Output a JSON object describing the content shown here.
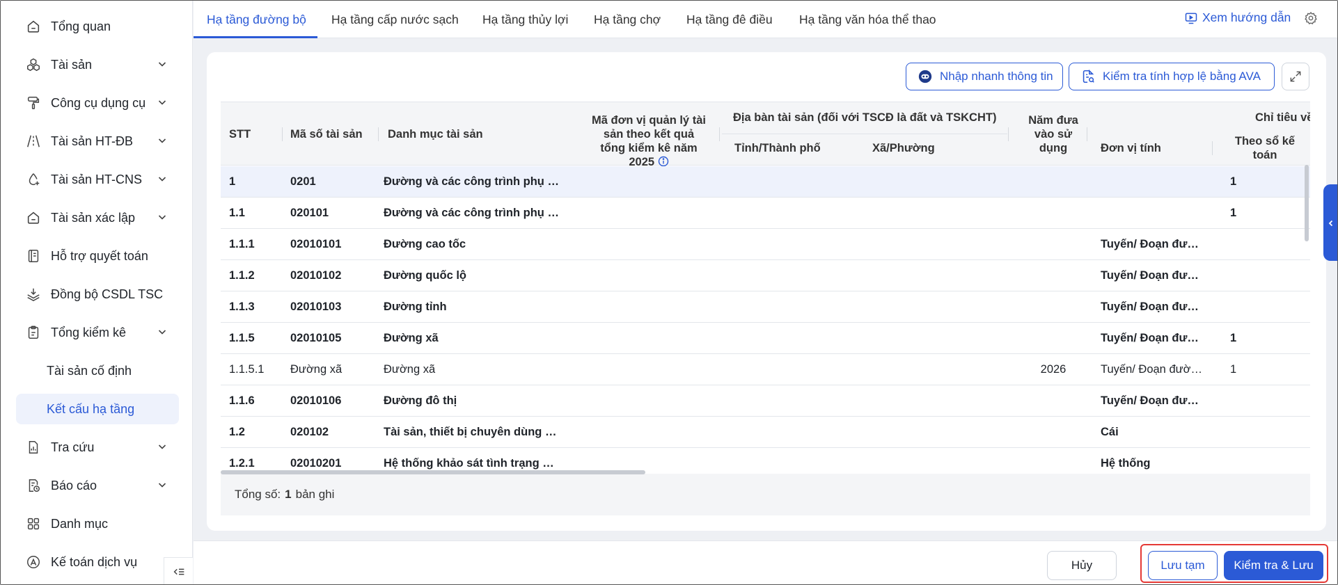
{
  "sidebar": {
    "items": [
      {
        "label": "Tổng quan",
        "icon": "home-icon",
        "has_chevron": false
      },
      {
        "label": "Tài sản",
        "icon": "cubes-icon",
        "has_chevron": true
      },
      {
        "label": "Công cụ dụng cụ",
        "icon": "paint-roller-icon",
        "has_chevron": true
      },
      {
        "label": "Tài sản HT-ĐB",
        "icon": "road-icon",
        "has_chevron": true
      },
      {
        "label": "Tài sản HT-CNS",
        "icon": "water-drop-icon",
        "has_chevron": true
      },
      {
        "label": "Tài sản xác lập",
        "icon": "building-icon",
        "has_chevron": true
      },
      {
        "label": "Hỗ trợ quyết toán",
        "icon": "ledger-icon",
        "has_chevron": false
      },
      {
        "label": "Đồng bộ CSDL TSC",
        "icon": "layers-sync-icon",
        "has_chevron": false
      },
      {
        "label": "Tổng kiểm kê",
        "icon": "clipboard-icon",
        "has_chevron": true
      },
      {
        "label": "Tài sản cố định",
        "icon": "",
        "has_chevron": false
      },
      {
        "label": "Kết cấu hạ tầng",
        "icon": "",
        "has_chevron": false
      },
      {
        "label": "Tra cứu",
        "icon": "document-chart-icon",
        "has_chevron": true
      },
      {
        "label": "Báo cáo",
        "icon": "report-clock-icon",
        "has_chevron": true
      },
      {
        "label": "Danh mục",
        "icon": "grid-icon",
        "has_chevron": false
      },
      {
        "label": "Kế toán dịch vụ",
        "icon": "accounting-icon",
        "has_chevron": false
      }
    ],
    "active_item": "Kết cấu hạ tầng"
  },
  "tabs": [
    {
      "label": "Hạ tầng đường bộ",
      "active": true
    },
    {
      "label": "Hạ tầng cấp nước sạch",
      "active": false
    },
    {
      "label": "Hạ tầng thủy lợi",
      "active": false
    },
    {
      "label": "Hạ tầng chợ",
      "active": false
    },
    {
      "label": "Hạ tầng đê điều",
      "active": false
    },
    {
      "label": "Hạ tầng văn hóa thể thao",
      "active": false
    }
  ],
  "header": {
    "guide_label": "Xem hướng dẫn"
  },
  "toolbar": {
    "quick_input_label": "Nhập nhanh thông tin",
    "validate_label": "Kiểm tra tính hợp lệ bằng AVA"
  },
  "table": {
    "headers": {
      "stt": "STT",
      "code": "Mã số tài sản",
      "category": "Danh mục tài sản",
      "unit_code": "Mã đơn vị quản lý tài sản theo kết quả tổng kiểm kê năm 2025",
      "location_group": "Địa bàn tài sản (đối với TSCĐ là đất và TSKCHT)",
      "province": "Tỉnh/Thành phố",
      "ward": "Xã/Phường",
      "year": "Năm đưa vào sử dụng",
      "unit": "Đơn vị tính",
      "indicator_group": "Chỉ tiêu về",
      "book": "Theo sổ kế toán"
    },
    "rows": [
      {
        "stt": "1",
        "code": "0201",
        "category": "Đường và các công trình phụ trợ g...",
        "year": "",
        "unit": "",
        "book": "1",
        "bold": true,
        "selected": true
      },
      {
        "stt": "1.1",
        "code": "020101",
        "category": "Đường và các công trình phụ trợ g...",
        "year": "",
        "unit": "",
        "book": "1",
        "bold": true,
        "selected": false
      },
      {
        "stt": "1.1.1",
        "code": "02010101",
        "category": "Đường cao tốc",
        "year": "",
        "unit": "Tuyến/ Đoạn đườn...",
        "book": "",
        "bold": true,
        "selected": false
      },
      {
        "stt": "1.1.2",
        "code": "02010102",
        "category": "Đường quốc lộ",
        "year": "",
        "unit": "Tuyến/ Đoạn đườn...",
        "book": "",
        "bold": true,
        "selected": false
      },
      {
        "stt": "1.1.3",
        "code": "02010103",
        "category": "Đường tỉnh",
        "year": "",
        "unit": "Tuyến/ Đoạn đườn...",
        "book": "",
        "bold": true,
        "selected": false
      },
      {
        "stt": "1.1.5",
        "code": "02010105",
        "category": "Đường xã",
        "year": "",
        "unit": "Tuyến/ Đoạn đườn...",
        "book": "1",
        "bold": true,
        "selected": false
      },
      {
        "stt": "1.1.5.1",
        "code": "Đường xã",
        "category": "Đường xã",
        "year": "2026",
        "unit": "Tuyến/ Đoạn đườn...",
        "book": "1",
        "bold": false,
        "selected": false
      },
      {
        "stt": "1.1.6",
        "code": "02010106",
        "category": "Đường đô thị",
        "year": "",
        "unit": "Tuyến/ Đoạn đườn...",
        "book": "",
        "bold": true,
        "selected": false
      },
      {
        "stt": "1.2",
        "code": "020102",
        "category": "Tài sản, thiết bị chuyên dùng phục ...",
        "year": "",
        "unit": "Cái",
        "book": "",
        "bold": true,
        "selected": false
      },
      {
        "stt": "1.2.1",
        "code": "02010201",
        "category": "Hệ thống khảo sát tình trạng mặt đ...",
        "year": "",
        "unit": "Hệ thống",
        "book": "",
        "bold": true,
        "selected": false
      }
    ]
  },
  "footer": {
    "total_prefix": "Tổng số:",
    "total_count": "1",
    "total_suffix": "bản ghi"
  },
  "actions": {
    "cancel_label": "Hủy",
    "draft_label": "Lưu tạm",
    "save_label": "Kiểm tra & Lưu"
  },
  "colors": {
    "accent": "#2b5ad6",
    "highlight": "#e53935"
  }
}
